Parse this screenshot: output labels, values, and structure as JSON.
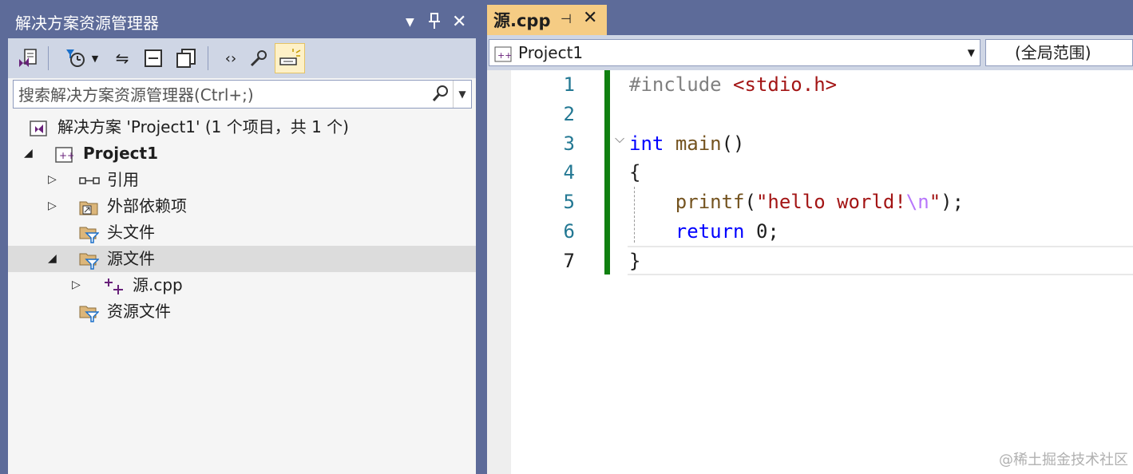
{
  "solution_explorer": {
    "title": "解决方案资源管理器",
    "search_placeholder": "搜索解决方案资源管理器(Ctrl+;)",
    "tree": {
      "solution": "解决方案 'Project1' (1 个项目，共 1 个)",
      "project": "Project1",
      "references": "引用",
      "external_deps": "外部依赖项",
      "header_files": "头文件",
      "source_files": "源文件",
      "source_file": "源.cpp",
      "resource_files": "资源文件"
    }
  },
  "editor": {
    "tab_label": "源.cpp",
    "project_combo": "Project1",
    "scope_combo": "(全局范围)",
    "line_numbers": [
      "1",
      "2",
      "3",
      "4",
      "5",
      "6",
      "7"
    ],
    "code": {
      "l1_directive": "#include",
      "l1_header": "<stdio.h>",
      "l3_type": "int",
      "l3_func": "main",
      "l3_rest": "()",
      "l4": "{",
      "l5_func": "printf",
      "l5_open": "(",
      "l5_str": "\"hello world!",
      "l5_esc": "\\n",
      "l5_str_end": "\"",
      "l5_close": ");",
      "l6_kw": "return",
      "l6_num": "0",
      "l6_end": ";",
      "l7": "}"
    }
  },
  "watermark": "@稀土掘金技术社区",
  "colors": {
    "chrome": "#5d6b99",
    "toolbar": "#cfd6e5",
    "active_tab": "#f5cc84",
    "keyword": "#0000ff",
    "string": "#a31515",
    "change_bar": "#108010"
  }
}
